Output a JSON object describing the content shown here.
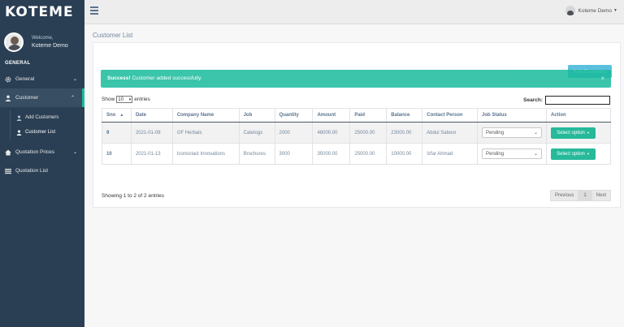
{
  "brand": {
    "logo_text": "KOTEME"
  },
  "sidebar": {
    "welcome": "Welcome,",
    "user_name": "Koteme Demo",
    "section_title": "GENERAL",
    "items": [
      {
        "label": "General",
        "icon": "gear-icon"
      },
      {
        "label": "Customer",
        "icon": "user-icon",
        "children": [
          {
            "label": "Add Customers"
          },
          {
            "label": "Customer List"
          }
        ]
      },
      {
        "label": "Quotation Prices",
        "icon": "home-icon"
      },
      {
        "label": "Quotation List",
        "icon": "list-icon"
      }
    ]
  },
  "topbar": {
    "user_name": "Koteme Demo"
  },
  "page": {
    "title": "Customer List"
  },
  "panel": {
    "add_button": "Add Customer",
    "alert_strong": "Success!",
    "alert_text": " Customer added successfully.",
    "alert_close": "×",
    "show_label": "Show",
    "entries_value": "10",
    "entries_label": "entries",
    "search_label": "Search:"
  },
  "table": {
    "columns": [
      "Sno",
      "Date",
      "Company Name",
      "Job",
      "Quantity",
      "Amount",
      "Paid",
      "Balance",
      "Contact Person",
      "Job Status",
      "Action"
    ],
    "rows": [
      {
        "sno": "9",
        "date": "2021-01-08",
        "company": "GF Herbals",
        "job": "Catelogs",
        "quantity": "2000",
        "amount": "48000.00",
        "paid": "25000.00",
        "balance": "23000.00",
        "contact": "Abdul Saboor",
        "status": "Pending",
        "action": "Select option"
      },
      {
        "sno": "10",
        "date": "2021-01-13",
        "company": "Iconoclast Innovations",
        "job": "Brochures",
        "quantity": "3000",
        "amount": "35000.00",
        "paid": "25000.00",
        "balance": "10000.00",
        "contact": "Izfar Ahmad",
        "status": "Pending",
        "action": "Select option"
      }
    ]
  },
  "footer": {
    "info": "Showing 1 to 2 of 2 entries",
    "previous": "Previous",
    "page": "1",
    "next": "Next"
  },
  "colors": {
    "sidebar": "#2a3f54",
    "accent": "#1abb9c",
    "info_button": "#5bc0de",
    "action_button": "#26b99a"
  }
}
